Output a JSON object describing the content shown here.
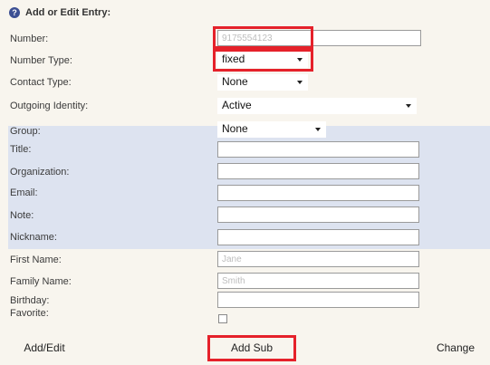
{
  "form": {
    "title": "Add or Edit Entry:",
    "help_icon": "question-circle-icon",
    "labels": {
      "number": "Number:",
      "number_type": "Number Type:",
      "contact_type": "Contact Type:",
      "outgoing_identity": "Outgoing Identity:",
      "group": "Group:",
      "title": "Title:",
      "organization": "Organization:",
      "email": "Email:",
      "note": "Note:",
      "nickname": "Nickname:",
      "first_name": "First Name:",
      "family_name": "Family Name:",
      "birthday": "Birthday:",
      "favorite": "Favorite:"
    },
    "values": {
      "number": "9175554123",
      "number_type": "fixed",
      "contact_type": "None",
      "outgoing_identity": "Active",
      "group": "None",
      "title": "",
      "organization": "",
      "email": "",
      "note": "",
      "nickname": "",
      "birthday": ""
    },
    "placeholders": {
      "first_name": "Jane",
      "family_name": "Smith"
    },
    "favorite_checked": false
  },
  "buttons": {
    "add_edit": "Add/Edit",
    "add_sub": "Add Sub",
    "change": "Change"
  },
  "colors": {
    "highlight": "#e5212a",
    "group_band": "#dde3f0",
    "background": "#f8f5ee"
  }
}
